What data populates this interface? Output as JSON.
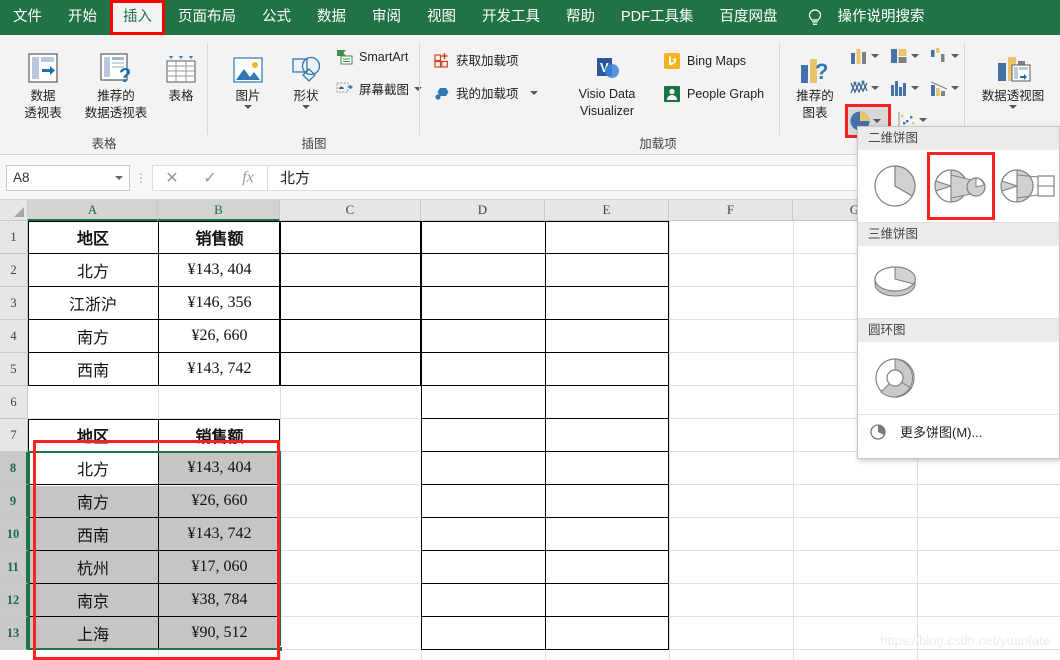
{
  "menu": {
    "items": [
      {
        "label": "文件",
        "active": false
      },
      {
        "label": "开始",
        "active": false
      },
      {
        "label": "插入",
        "active": true
      },
      {
        "label": "页面布局",
        "active": false
      },
      {
        "label": "公式",
        "active": false
      },
      {
        "label": "数据",
        "active": false
      },
      {
        "label": "审阅",
        "active": false
      },
      {
        "label": "视图",
        "active": false
      },
      {
        "label": "开发工具",
        "active": false
      },
      {
        "label": "帮助",
        "active": false
      },
      {
        "label": "PDF工具集",
        "active": false
      },
      {
        "label": "百度网盘",
        "active": false
      }
    ],
    "tell_me": "操作说明搜索"
  },
  "ribbon": {
    "groups": [
      {
        "label": "表格"
      },
      {
        "label": "插图"
      },
      {
        "label": "加载项"
      },
      {
        "label": ""
      },
      {
        "label": ""
      }
    ],
    "pivot_table": "数据\n透视表",
    "pivot_table_l1": "数据",
    "pivot_table_l2": "透视表",
    "recommended_pivot_l1": "推荐的",
    "recommended_pivot_l2": "数据透视表",
    "table": "表格",
    "picture": "图片",
    "shapes": "形状",
    "smartart": "SmartArt",
    "screenshot": "屏幕截图",
    "get_addins": "获取加载项",
    "my_addins": "我的加载项",
    "visio_l1": "Visio Data",
    "visio_l2": "Visualizer",
    "bing_maps": "Bing Maps",
    "people_graph": "People Graph",
    "recommended_charts_l1": "推荐的",
    "recommended_charts_l2": "图表",
    "pivot_chart": "数据透视图"
  },
  "pie_dropdown": {
    "section_2d": "二维饼图",
    "section_3d": "三维饼图",
    "section_doughnut": "圆环图",
    "more": "更多饼图(M)...",
    "highlighted_index": 1
  },
  "formula_bar": {
    "name_box": "A8",
    "cancel_icon": "✕",
    "confirm_icon": "✓",
    "function_icon": "fx",
    "value": "北方"
  },
  "sheet": {
    "columns": [
      "A",
      "B",
      "C",
      "D",
      "E",
      "F",
      "G"
    ],
    "rows": [
      "1",
      "2",
      "3",
      "4",
      "5",
      "6",
      "7",
      "8",
      "9",
      "10",
      "11",
      "12",
      "13"
    ],
    "selected_range": "A8:B13",
    "selected_columns": [
      "A",
      "B"
    ],
    "selected_rows": [
      "8",
      "9",
      "10",
      "11",
      "12",
      "13"
    ],
    "cells": [
      {
        "row": 1,
        "col": "A",
        "value": "地区",
        "bold": true
      },
      {
        "row": 1,
        "col": "B",
        "value": "销售额",
        "bold": true
      },
      {
        "row": 2,
        "col": "A",
        "value": "北方",
        "bold": false
      },
      {
        "row": 2,
        "col": "B",
        "value": "¥143, 404",
        "bold": false
      },
      {
        "row": 3,
        "col": "A",
        "value": "江浙沪",
        "bold": false
      },
      {
        "row": 3,
        "col": "B",
        "value": "¥146, 356",
        "bold": false
      },
      {
        "row": 4,
        "col": "A",
        "value": "南方",
        "bold": false
      },
      {
        "row": 4,
        "col": "B",
        "value": "¥26, 660",
        "bold": false
      },
      {
        "row": 5,
        "col": "A",
        "value": "西南",
        "bold": false
      },
      {
        "row": 5,
        "col": "B",
        "value": "¥143, 742",
        "bold": false
      },
      {
        "row": 7,
        "col": "A",
        "value": "地区",
        "bold": true
      },
      {
        "row": 7,
        "col": "B",
        "value": "销售额",
        "bold": true
      },
      {
        "row": 8,
        "col": "A",
        "value": "北方",
        "bold": false
      },
      {
        "row": 8,
        "col": "B",
        "value": "¥143, 404",
        "bold": false
      },
      {
        "row": 9,
        "col": "A",
        "value": "南方",
        "bold": false
      },
      {
        "row": 9,
        "col": "B",
        "value": "¥26, 660",
        "bold": false
      },
      {
        "row": 10,
        "col": "A",
        "value": "西南",
        "bold": false
      },
      {
        "row": 10,
        "col": "B",
        "value": "¥143, 742",
        "bold": false
      },
      {
        "row": 11,
        "col": "A",
        "value": "杭州",
        "bold": false
      },
      {
        "row": 11,
        "col": "B",
        "value": "¥17, 060",
        "bold": false
      },
      {
        "row": 12,
        "col": "A",
        "value": "南京",
        "bold": false
      },
      {
        "row": 12,
        "col": "B",
        "value": "¥38, 784",
        "bold": false
      },
      {
        "row": 13,
        "col": "A",
        "value": "上海",
        "bold": false
      },
      {
        "row": 13,
        "col": "B",
        "value": "¥90, 512",
        "bold": false
      }
    ]
  },
  "watermark": "https://blog.csdn.net/yuanfate",
  "colors": {
    "excel_green": "#217346",
    "highlight_red": "#ff2020",
    "selection_green": "#217346",
    "ribbon_bg": "#f3f3f3",
    "header_gray": "#e6e6e6",
    "shaded_cell": "#c5c5c5"
  }
}
